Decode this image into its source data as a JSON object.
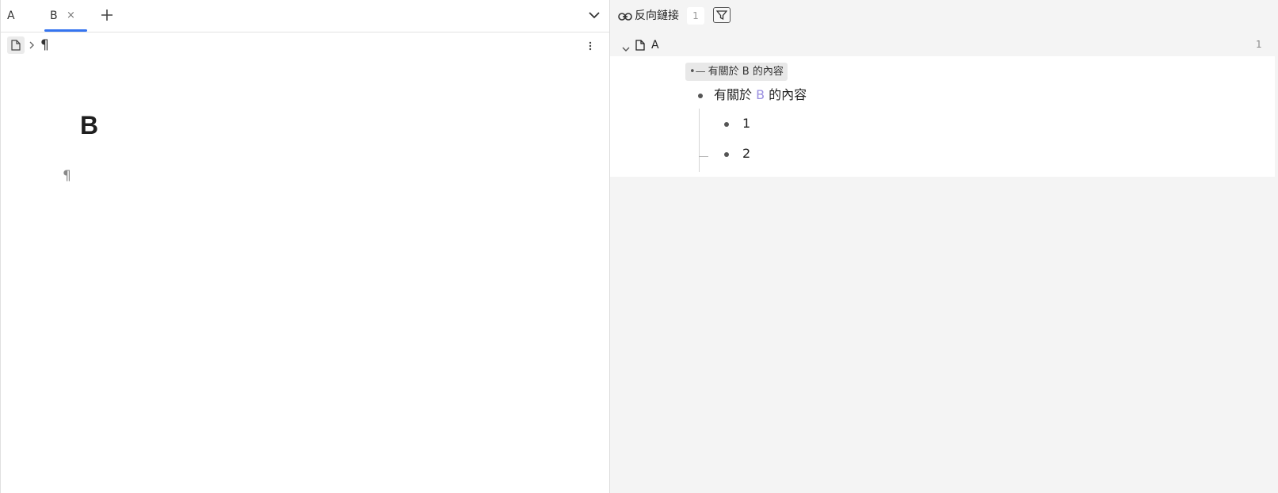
{
  "tabs": [
    {
      "label": "A",
      "active": false
    },
    {
      "label": "B",
      "active": true
    }
  ],
  "tab_close_glyph": "×",
  "tab_add_icon": "plus-icon",
  "tab_menu_icon": "chevron-down-icon",
  "breadcrumb": {
    "root_icon": "document-icon",
    "separator_icon": "chevron-right-icon",
    "current": "¶"
  },
  "editor": {
    "title": "B",
    "paragraph_mark": "¶",
    "more_icon": "more-vertical-icon"
  },
  "backlinks": {
    "title": "反向鏈接",
    "count": "1",
    "filter_icon": "filter-icon",
    "link_icon": "link-icon",
    "groups": [
      {
        "doc": "A",
        "count": "1",
        "breadcrumb_chip": "有關於 B 的內容",
        "block": {
          "text_before": "有關於 ",
          "ref": "B",
          "text_after": " 的內容"
        },
        "children": [
          "1",
          "2"
        ]
      }
    ]
  },
  "colors": {
    "accent": "#3574f0",
    "ref": "#9a8fe0",
    "panel_bg": "#f4f4f4"
  }
}
